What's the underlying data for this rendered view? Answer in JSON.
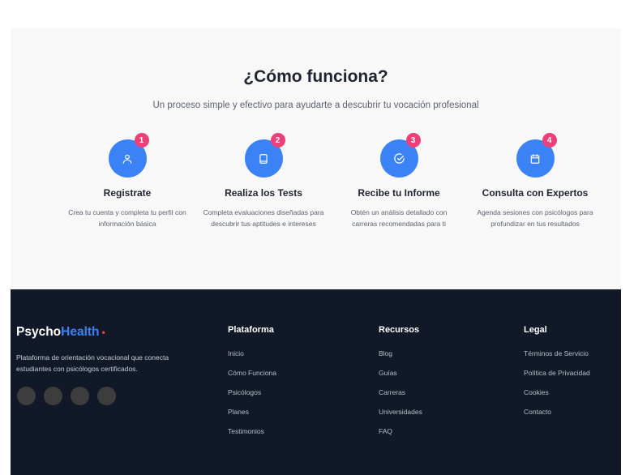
{
  "how": {
    "title": "¿Cómo funciona?",
    "subtitle": "Un proceso simple y efectivo para ayudarte a descubrir tu vocación profesional",
    "steps": [
      {
        "number": "1",
        "icon": "user-icon",
        "title": "Registrate",
        "desc": "Crea tu cuenta y completa tu perfil con información básica"
      },
      {
        "number": "2",
        "icon": "book-icon",
        "title": "Realiza los Tests",
        "desc": "Completa evaluaciones diseñadas para descubrir tus aptitudes e intereses"
      },
      {
        "number": "3",
        "icon": "check-circle-icon",
        "title": "Recibe tu Informe",
        "desc": "Obtén un análisis detallado con carreras recomendadas para ti"
      },
      {
        "number": "4",
        "icon": "calendar-icon",
        "title": "Consulta con Expertos",
        "desc": "Agenda sesiones con psicólogos para profundizar en tus resultados"
      }
    ]
  },
  "footer": {
    "brand_first": "Psycho",
    "brand_second": "Health",
    "brand_dot": "•",
    "description": "Plataforma de orientación vocacional que conecta estudiantes con psicólogos certificados.",
    "columns": [
      {
        "title": "Plataforma",
        "links": [
          "Inicio",
          "Cómo Funciona",
          "Psicólogos",
          "Planes",
          "Testimonios"
        ]
      },
      {
        "title": "Recursos",
        "links": [
          "Blog",
          "Guías",
          "Carreras",
          "Universidades",
          "FAQ"
        ]
      },
      {
        "title": "Legal",
        "links": [
          "Términos de Servicio",
          "Política de Privacidad",
          "Cookies",
          "Contacto"
        ]
      }
    ]
  },
  "colors": {
    "accent": "#3b82f6",
    "badge": "#ec4079",
    "footer_bg": "#111827",
    "section_bg": "#f8f8f8"
  }
}
